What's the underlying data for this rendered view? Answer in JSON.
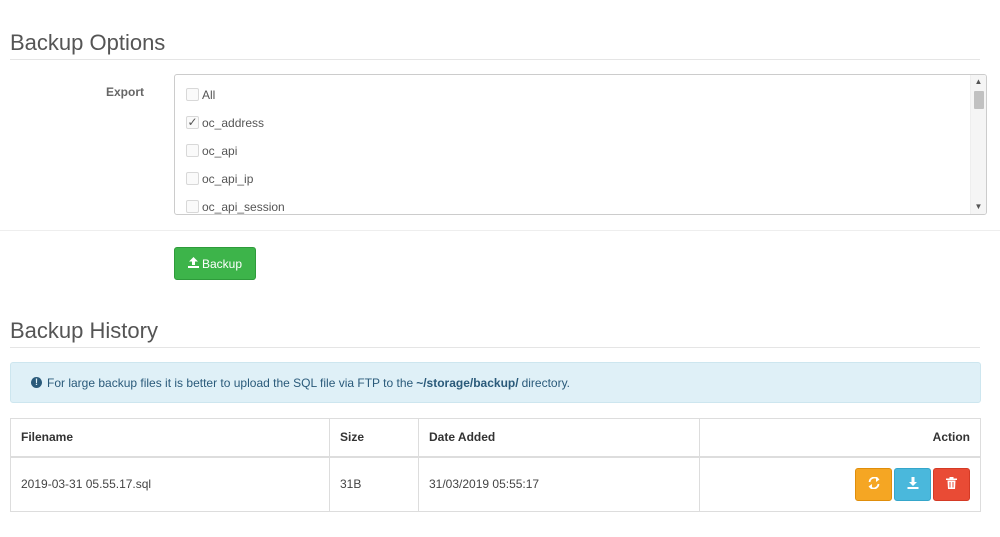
{
  "sections": {
    "options_title": "Backup Options",
    "history_title": "Backup History"
  },
  "export": {
    "label": "Export",
    "items": [
      {
        "label": "All",
        "checked": false
      },
      {
        "label": "oc_address",
        "checked": true
      },
      {
        "label": "oc_api",
        "checked": false
      },
      {
        "label": "oc_api_ip",
        "checked": false
      },
      {
        "label": "oc_api_session",
        "checked": false
      }
    ]
  },
  "buttons": {
    "backup_label": "Backup"
  },
  "alert": {
    "text_before": "For large backup files it is better to upload the SQL file via FTP to the",
    "path": "~/storage/backup/",
    "text_after": "directory."
  },
  "table": {
    "headers": {
      "filename": "Filename",
      "size": "Size",
      "date_added": "Date Added",
      "action": "Action"
    },
    "rows": [
      {
        "filename": "2019-03-31 05.55.17.sql",
        "size": "31B",
        "date_added": "31/03/2019 05:55:17"
      }
    ]
  },
  "icons": {
    "restore": "refresh-icon",
    "download": "download-icon",
    "delete": "trash-icon"
  },
  "colors": {
    "success": "#3db44a",
    "warning": "#f5a623",
    "info": "#4ab8dc",
    "danger": "#e94b35",
    "alert_bg": "#dff0f7"
  }
}
